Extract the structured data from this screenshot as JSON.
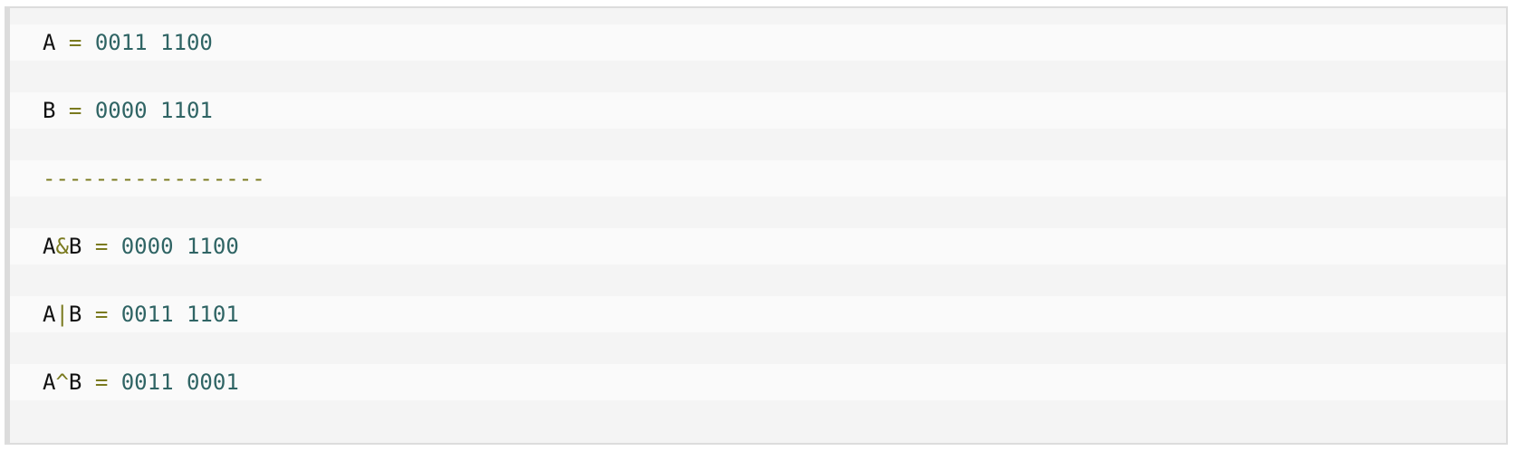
{
  "code": {
    "lines": [
      {
        "lhs": "A",
        "op": "",
        "rhs": "",
        "eq": "=",
        "value": "0011 1100"
      },
      {
        "lhs": "B",
        "op": "",
        "rhs": "",
        "eq": "=",
        "value": "0000 1101"
      },
      {
        "separator": "-----------------"
      },
      {
        "lhs": "A",
        "op": "&",
        "rhs": "B",
        "eq": "=",
        "value": "0000 1100"
      },
      {
        "lhs": "A",
        "op": "|",
        "rhs": "B",
        "eq": "=",
        "value": "0011 1101"
      },
      {
        "lhs": "A",
        "op": "^",
        "rhs": "B",
        "eq": "=",
        "value": "0011 0001"
      }
    ]
  }
}
